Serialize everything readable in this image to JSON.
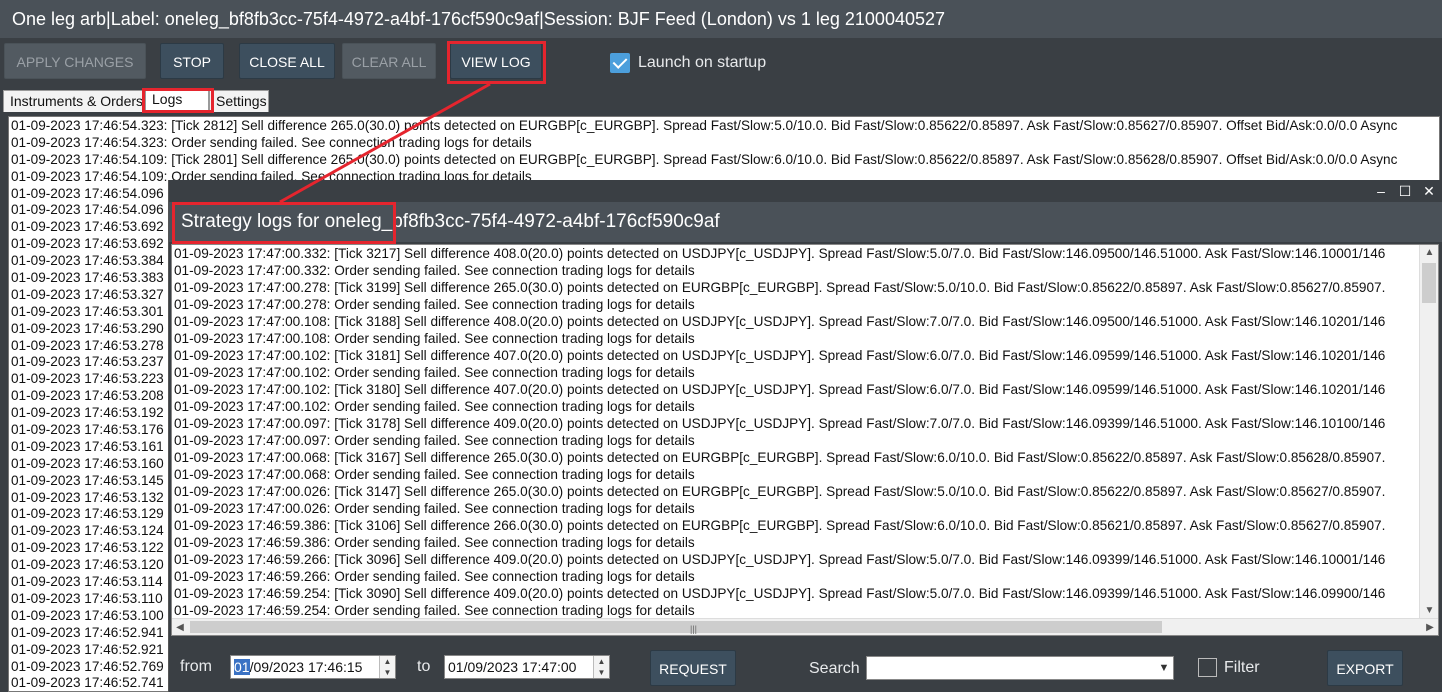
{
  "window": {
    "title": "One leg arb|Label: oneleg_bf8fb3cc-75f4-4972-a4bf-176cf590c9af|Session: BJF Feed (London) vs 1 leg 2100040527"
  },
  "toolbar": {
    "apply_label": "APPLY CHANGES",
    "stop_label": "STOP",
    "close_all_label": "CLOSE ALL",
    "clear_all_label": "CLEAR ALL",
    "view_log_label": "VIEW LOG",
    "launch_label": "Launch on startup",
    "launch_checked": true
  },
  "tabs": [
    "Instruments & Orders",
    "Logs",
    "Settings"
  ],
  "main_log": {
    "lines": [
      "01-09-2023 17:46:54.323: [Tick 2812] Sell difference 265.0(30.0) points detected on EURGBP[c_EURGBP]. Spread Fast/Slow:5.0/10.0. Bid Fast/Slow:0.85622/0.85897. Ask Fast/Slow:0.85627/0.85907. Offset Bid/Ask:0.0/0.0 Async",
      "01-09-2023 17:46:54.323: Order sending failed. See connection trading logs for details",
      "01-09-2023 17:46:54.109: [Tick 2801] Sell difference 265.0(30.0) points detected on EURGBP[c_EURGBP]. Spread Fast/Slow:6.0/10.0. Bid Fast/Slow:0.85622/0.85897. Ask Fast/Slow:0.85628/0.85907. Offset Bid/Ask:0.0/0.0 Async",
      "01-09-2023 17:46:54.109: Order sending failed. See connection trading logs for details",
      "01-09-2023 17:46:54.096",
      "01-09-2023 17:46:54.096",
      "01-09-2023 17:46:53.692",
      "01-09-2023 17:46:53.692",
      "01-09-2023 17:46:53.384",
      "01-09-2023 17:46:53.383",
      "01-09-2023 17:46:53.327",
      "01-09-2023 17:46:53.301",
      "01-09-2023 17:46:53.290",
      "01-09-2023 17:46:53.278",
      "01-09-2023 17:46:53.237",
      "01-09-2023 17:46:53.223",
      "01-09-2023 17:46:53.208",
      "01-09-2023 17:46:53.192",
      "01-09-2023 17:46:53.176",
      "01-09-2023 17:46:53.161",
      "01-09-2023 17:46:53.160",
      "01-09-2023 17:46:53.145",
      "01-09-2023 17:46:53.132",
      "01-09-2023 17:46:53.129",
      "01-09-2023 17:46:53.124",
      "01-09-2023 17:46:53.122",
      "01-09-2023 17:46:53.120",
      "01-09-2023 17:46:53.114",
      "01-09-2023 17:46:53.110",
      "01-09-2023 17:46:53.100",
      "01-09-2023 17:46:52.941",
      "01-09-2023 17:46:52.921",
      "01-09-2023 17:46:52.769",
      "01-09-2023 17:46:52.741"
    ]
  },
  "popup": {
    "title": "Strategy logs for oneleg_bf8fb3cc-75f4-4972-a4bf-176cf590c9af",
    "controls": {
      "minimize": "–",
      "maximize": "☐",
      "close": "✕"
    },
    "lines": [
      "01-09-2023 17:47:00.332: [Tick 3217] Sell difference 408.0(20.0) points detected on USDJPY[c_USDJPY]. Spread Fast/Slow:5.0/7.0. Bid Fast/Slow:146.09500/146.51000. Ask Fast/Slow:146.10001/146",
      "01-09-2023 17:47:00.332: Order sending failed. See connection trading logs for details",
      "01-09-2023 17:47:00.278: [Tick 3199] Sell difference 265.0(30.0) points detected on EURGBP[c_EURGBP]. Spread Fast/Slow:5.0/10.0. Bid Fast/Slow:0.85622/0.85897. Ask Fast/Slow:0.85627/0.85907.",
      "01-09-2023 17:47:00.278: Order sending failed. See connection trading logs for details",
      "01-09-2023 17:47:00.108: [Tick 3188] Sell difference 408.0(20.0) points detected on USDJPY[c_USDJPY]. Spread Fast/Slow:7.0/7.0. Bid Fast/Slow:146.09500/146.51000. Ask Fast/Slow:146.10201/146",
      "01-09-2023 17:47:00.108: Order sending failed. See connection trading logs for details",
      "01-09-2023 17:47:00.102: [Tick 3181] Sell difference 407.0(20.0) points detected on USDJPY[c_USDJPY]. Spread Fast/Slow:6.0/7.0. Bid Fast/Slow:146.09599/146.51000. Ask Fast/Slow:146.10201/146",
      "01-09-2023 17:47:00.102: Order sending failed. See connection trading logs for details",
      "01-09-2023 17:47:00.102: [Tick 3180] Sell difference 407.0(20.0) points detected on USDJPY[c_USDJPY]. Spread Fast/Slow:6.0/7.0. Bid Fast/Slow:146.09599/146.51000. Ask Fast/Slow:146.10201/146",
      "01-09-2023 17:47:00.102: Order sending failed. See connection trading logs for details",
      "01-09-2023 17:47:00.097: [Tick 3178] Sell difference 409.0(20.0) points detected on USDJPY[c_USDJPY]. Spread Fast/Slow:7.0/7.0. Bid Fast/Slow:146.09399/146.51000. Ask Fast/Slow:146.10100/146",
      "01-09-2023 17:47:00.097: Order sending failed. See connection trading logs for details",
      "01-09-2023 17:47:00.068: [Tick 3167] Sell difference 265.0(30.0) points detected on EURGBP[c_EURGBP]. Spread Fast/Slow:6.0/10.0. Bid Fast/Slow:0.85622/0.85897. Ask Fast/Slow:0.85628/0.85907.",
      "01-09-2023 17:47:00.068: Order sending failed. See connection trading logs for details",
      "01-09-2023 17:47:00.026: [Tick 3147] Sell difference 265.0(30.0) points detected on EURGBP[c_EURGBP]. Spread Fast/Slow:5.0/10.0. Bid Fast/Slow:0.85622/0.85897. Ask Fast/Slow:0.85627/0.85907.",
      "01-09-2023 17:47:00.026: Order sending failed. See connection trading logs for details",
      "01-09-2023 17:46:59.386: [Tick 3106] Sell difference 266.0(30.0) points detected on EURGBP[c_EURGBP]. Spread Fast/Slow:6.0/10.0. Bid Fast/Slow:0.85621/0.85897. Ask Fast/Slow:0.85627/0.85907.",
      "01-09-2023 17:46:59.386: Order sending failed. See connection trading logs for details",
      "01-09-2023 17:46:59.266: [Tick 3096] Sell difference 409.0(20.0) points detected on USDJPY[c_USDJPY]. Spread Fast/Slow:5.0/7.0. Bid Fast/Slow:146.09399/146.51000. Ask Fast/Slow:146.10001/146",
      "01-09-2023 17:46:59.266: Order sending failed. See connection trading logs for details",
      "01-09-2023 17:46:59.254: [Tick 3090] Sell difference 409.0(20.0) points detected on USDJPY[c_USDJPY]. Spread Fast/Slow:5.0/7.0. Bid Fast/Slow:146.09399/146.51000. Ask Fast/Slow:146.09900/146",
      "01-09-2023 17:46:59.254: Order sending failed. See connection trading logs for details"
    ],
    "from_label": "from",
    "from_value_sel": "01",
    "from_value_rest": "/09/2023 17:46:15",
    "to_label": "to",
    "to_value": "01/09/2023 17:47:00",
    "request_label": "REQUEST",
    "search_label": "Search",
    "search_value": "",
    "filter_label": "Filter",
    "filter_checked": false,
    "export_label": "EXPORT"
  },
  "colors": {
    "annotation": "#e5252e",
    "accent": "#4c9fdc",
    "button": "#3d4f5e"
  }
}
